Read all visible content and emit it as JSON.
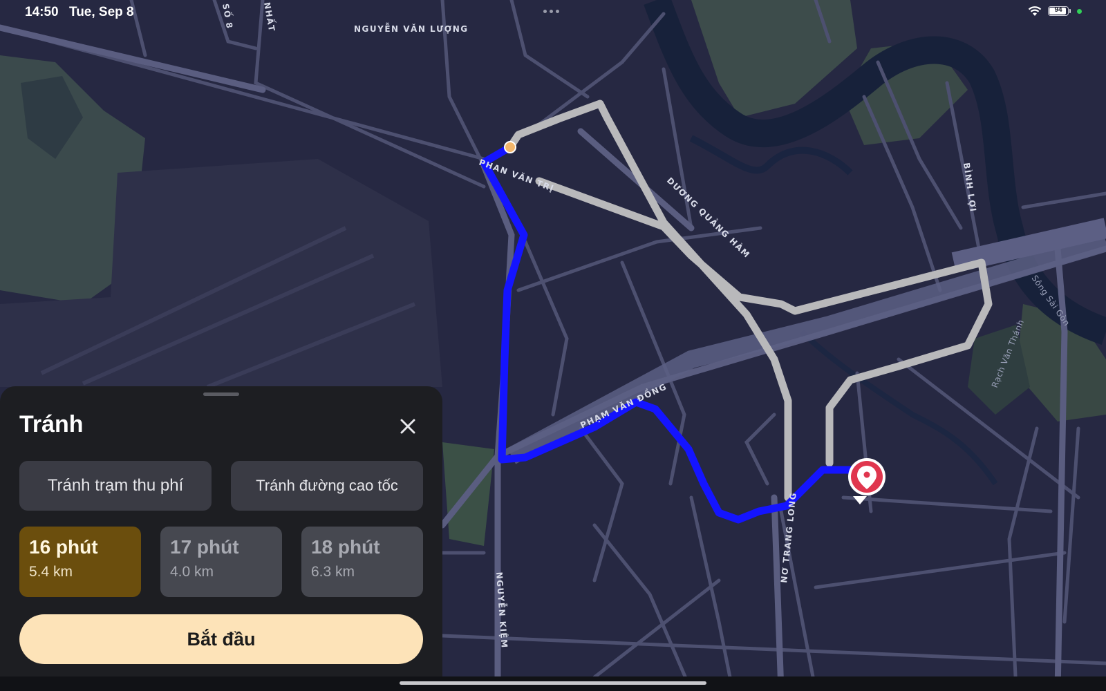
{
  "status_bar": {
    "time": "14:50",
    "date": "Tue, Sep 8",
    "battery": "94",
    "battery_level": 0.94
  },
  "map": {
    "street_labels": [
      "NGUYỄN VĂN LƯỢNG",
      "SỐ 8",
      "NHẤT",
      "PHAN VĂN TRỊ",
      "DƯƠNG QUẢNG HÀM",
      "BÌNH LỢI",
      "Sông Sài Gòn",
      "Rạch Văn Thánh",
      "PHẠM VĂN ĐỒNG",
      "NƠ TRANG LONG",
      "NGUYỄN KIỆM"
    ],
    "route_color": "#1414ff",
    "alt_route_color": "#b9b9bb",
    "destination_pin_color": "#e0364e",
    "origin_dot_color": "#f2b66b"
  },
  "sheet": {
    "title": "Tránh",
    "avoid_tolls_label": "Tránh trạm thu phí",
    "avoid_highways_label": "Tránh đường cao tốc",
    "routes": [
      {
        "time": "16 phút",
        "distance": "5.4 km",
        "selected": true
      },
      {
        "time": "17 phút",
        "distance": "4.0 km",
        "selected": false
      },
      {
        "time": "18 phút",
        "distance": "6.3 km",
        "selected": false
      }
    ],
    "start_label": "Bắt đầu",
    "selected_color": "#6b4e0d",
    "start_button_color": "#fde3b8"
  }
}
